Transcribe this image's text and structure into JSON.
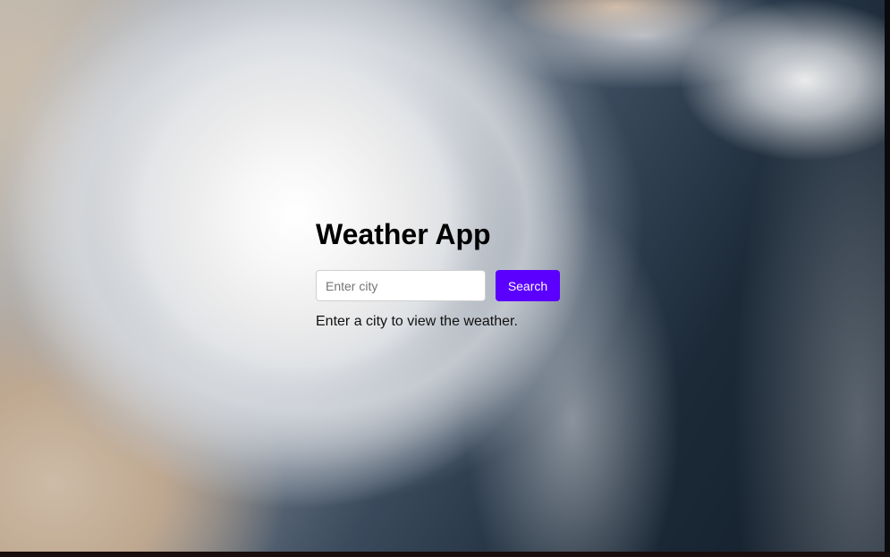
{
  "app": {
    "title": "Weather App"
  },
  "search": {
    "placeholder": "Enter city",
    "value": "",
    "button_label": "Search"
  },
  "status": {
    "message": "Enter a city to view the weather."
  },
  "colors": {
    "accent": "#5b00ff",
    "text": "#000000"
  }
}
